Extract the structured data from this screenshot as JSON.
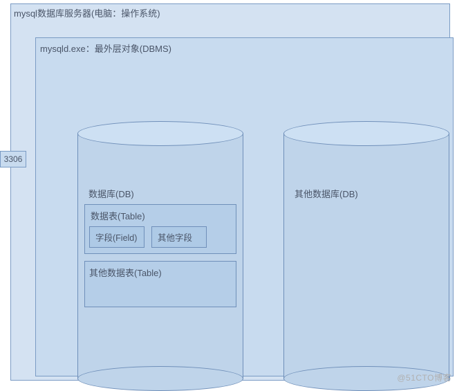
{
  "server": {
    "title": "mysql数据库服务器(电脑：操作系统)",
    "port": "3306"
  },
  "dbms": {
    "title": "mysqld.exe：最外层对象(DBMS)"
  },
  "database": {
    "label": "数据库(DB)",
    "table": {
      "label": "数据表(Table)",
      "field": "字段(Field)",
      "other_field": "其他字段"
    },
    "other_table": "其他数据表(Table)"
  },
  "other_database": {
    "label": "其他数据库(DB)"
  },
  "watermark": "@51CTO博客"
}
